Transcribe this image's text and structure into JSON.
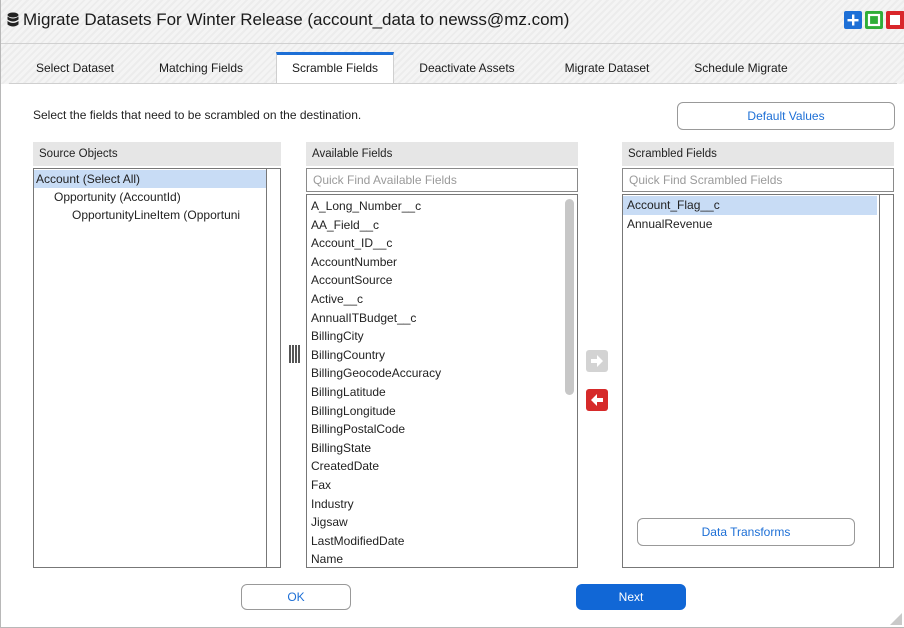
{
  "window": {
    "title": "Migrate Datasets For Winter Release (account_data to newss@mz.com)",
    "icon": "database-icon",
    "controls": [
      "add-icon",
      "maximize-icon",
      "close-icon"
    ]
  },
  "tabs": [
    {
      "label": "Select Dataset",
      "active": false
    },
    {
      "label": "Matching Fields",
      "active": false
    },
    {
      "label": "Scramble Fields",
      "active": true
    },
    {
      "label": "Deactivate Assets",
      "active": false
    },
    {
      "label": "Migrate Dataset",
      "active": false
    },
    {
      "label": "Schedule Migrate",
      "active": false
    }
  ],
  "instruction": "Select the fields that need to be scrambled on the destination.",
  "default_values_label": "Default Values",
  "source": {
    "header": "Source Objects",
    "items": [
      {
        "label": "Account (Select All)",
        "selected": true
      },
      {
        "label": "Opportunity (AccountId)",
        "selected": false
      },
      {
        "label": "OpportunityLineItem (Opportuni",
        "selected": false
      }
    ]
  },
  "available": {
    "header": "Available Fields",
    "placeholder": "Quick Find Available Fields",
    "items": [
      "A_Long_Number__c",
      "AA_Field__c",
      "Account_ID__c",
      "AccountNumber",
      "AccountSource",
      "Active__c",
      "AnnualITBudget__c",
      "BillingCity",
      "BillingCountry",
      "BillingGeocodeAccuracy",
      "BillingLatitude",
      "BillingLongitude",
      "BillingPostalCode",
      "BillingState",
      "CreatedDate",
      "Fax",
      "Industry",
      "Jigsaw",
      "LastModifiedDate",
      "Name"
    ]
  },
  "scrambled": {
    "header": "Scrambled Fields",
    "placeholder": "Quick Find Scrambled Fields",
    "items": [
      {
        "label": "Account_Flag__c",
        "selected": true
      },
      {
        "label": "AnnualRevenue",
        "selected": false
      }
    ],
    "data_transforms_label": "Data Transforms"
  },
  "footer": {
    "ok_label": "OK",
    "next_label": "Next"
  },
  "colors": {
    "accent": "#1167d6",
    "selection": "#c8dcf5",
    "remove_button": "#d62a2a",
    "add_button_disabled": "#d3d3d3"
  }
}
